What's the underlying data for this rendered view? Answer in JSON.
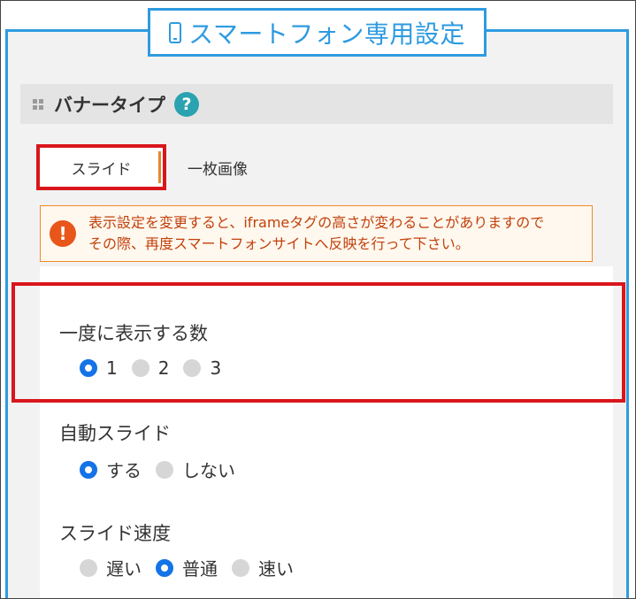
{
  "header": {
    "title": "スマートフォン専用設定",
    "icon": "smartphone-icon",
    "accent_color": "#2e9be0"
  },
  "section": {
    "title": "バナータイプ",
    "help_icon": "question-icon",
    "help_glyph": "?"
  },
  "tabs": [
    {
      "label": "スライド",
      "selected": true
    },
    {
      "label": "一枚画像",
      "selected": false
    }
  ],
  "warning": {
    "icon": "exclamation-icon",
    "glyph": "!",
    "line1": "表示設定を変更すると、iframeタグの高さが変わることがありますので",
    "line2": "その際、再度スマートフォンサイトへ反映を行って下さい。",
    "color": "#e8561a"
  },
  "settings": {
    "display_count": {
      "label": "一度に表示する数",
      "options": [
        "1",
        "2",
        "3"
      ],
      "selected": "1"
    },
    "auto_slide": {
      "label": "自動スライド",
      "options": [
        "する",
        "しない"
      ],
      "selected": "する"
    },
    "slide_speed": {
      "label": "スライド速度",
      "options": [
        "遅い",
        "普通",
        "速い"
      ],
      "selected": "普通"
    }
  },
  "highlight_color": "#d9161c",
  "radio_checked_color": "#1473e6"
}
